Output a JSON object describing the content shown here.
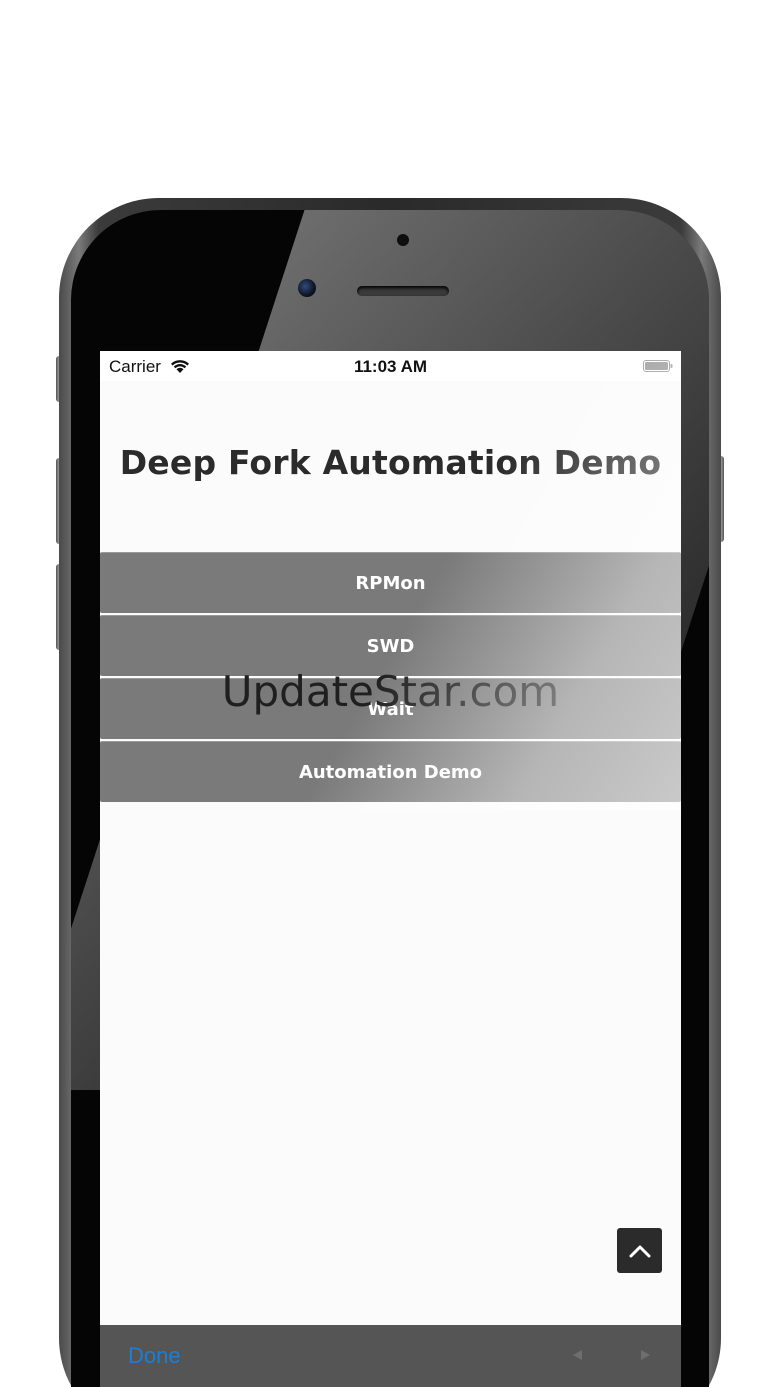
{
  "status_bar": {
    "carrier": "Carrier",
    "time": "11:03 AM",
    "wifi_icon": "wifi-icon",
    "battery_icon": "battery-icon"
  },
  "app": {
    "title": "Deep Fork Automation Demo",
    "menu_items": [
      {
        "label": "RPMon"
      },
      {
        "label": "SWD"
      },
      {
        "label": "Wait"
      },
      {
        "label": "Automation Demo"
      }
    ],
    "scroll_top_icon": "chevron-up-icon"
  },
  "toolbar": {
    "done_label": "Done",
    "prev_icon": "triangle-left-icon",
    "next_icon": "triangle-right-icon"
  },
  "watermark": "UpdateStar.com",
  "colors": {
    "menu_bg": "#7a7a7a",
    "toolbar_bg": "#555555",
    "done_blue": "#1a7fd6",
    "scroll_top_bg": "#2b2b2b"
  }
}
